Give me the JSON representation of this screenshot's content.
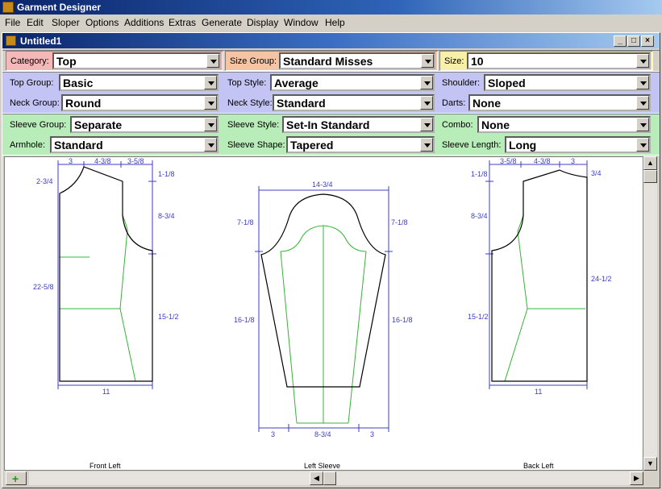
{
  "app": {
    "title": "Garment Designer"
  },
  "menu": [
    "File",
    "Edit",
    "Sloper",
    "Options",
    "Additions",
    "Extras",
    "Generate",
    "Display",
    "Window",
    "Help"
  ],
  "document": {
    "title": "Untitled1"
  },
  "colors": {
    "category_band": "#f4b8b8",
    "sizegroup_band": "#f4c4a4",
    "size_band": "#f8f0a8",
    "top_band": "#c4c4f4",
    "sleeve_band": "#b8ecb8",
    "dim_blue": "#3c3cc8",
    "sloper_green": "#34b434"
  },
  "fields": {
    "category": {
      "label": "Category:",
      "value": "Top"
    },
    "size_group": {
      "label": "Size Group:",
      "value": "Standard Misses"
    },
    "size": {
      "label": "Size:",
      "value": "10"
    },
    "top_group": {
      "label": "Top Group:",
      "value": "Basic"
    },
    "top_style": {
      "label": "Top Style:",
      "value": "Average"
    },
    "shoulder": {
      "label": "Shoulder:",
      "value": "Sloped"
    },
    "neck_group": {
      "label": "Neck Group:",
      "value": "Round"
    },
    "neck_style": {
      "label": "Neck Style:",
      "value": "Standard"
    },
    "darts": {
      "label": "Darts:",
      "value": "None"
    },
    "sleeve_group": {
      "label": "Sleeve Group:",
      "value": "Separate"
    },
    "sleeve_style": {
      "label": "Sleeve Style:",
      "value": "Set-In Standard"
    },
    "combo": {
      "label": "Combo:",
      "value": "None"
    },
    "armhole": {
      "label": "Armhole:",
      "value": "Standard"
    },
    "sleeve_shape": {
      "label": "Sleeve Shape:",
      "value": "Tapered"
    },
    "sleeve_length": {
      "label": "Sleeve Length:",
      "value": "Long"
    }
  },
  "pieces": {
    "front": {
      "caption": "Front Left",
      "dims": {
        "top_a": "3",
        "top_b": "4-3/8",
        "top_c": "3-5/8",
        "left_top": "2-3/4",
        "right_top": "1-1/8",
        "right_arm": "8-3/4",
        "left_len": "22-5/8",
        "right_side": "15-1/2",
        "bottom": "11"
      }
    },
    "sleeve": {
      "caption": "Left Sleeve",
      "dims": {
        "top": "14-3/4",
        "left_cap": "7-1/8",
        "right_cap": "7-1/8",
        "left_len": "16-1/8",
        "right_len": "16-1/8",
        "bottom_a": "3",
        "bottom_b": "8-3/4",
        "bottom_c": "3"
      }
    },
    "back": {
      "caption": "Back Left",
      "dims": {
        "top_a": "3-5/8",
        "top_b": "4-3/8",
        "top_c": "3",
        "left_top": "1-1/8",
        "right_top": "3/4",
        "left_arm": "8-3/4",
        "right_len": "24-1/2",
        "left_side": "15-1/2",
        "bottom": "11"
      }
    }
  },
  "scroll": {
    "up": "▲",
    "down": "▼",
    "left": "◀",
    "right": "▶"
  }
}
